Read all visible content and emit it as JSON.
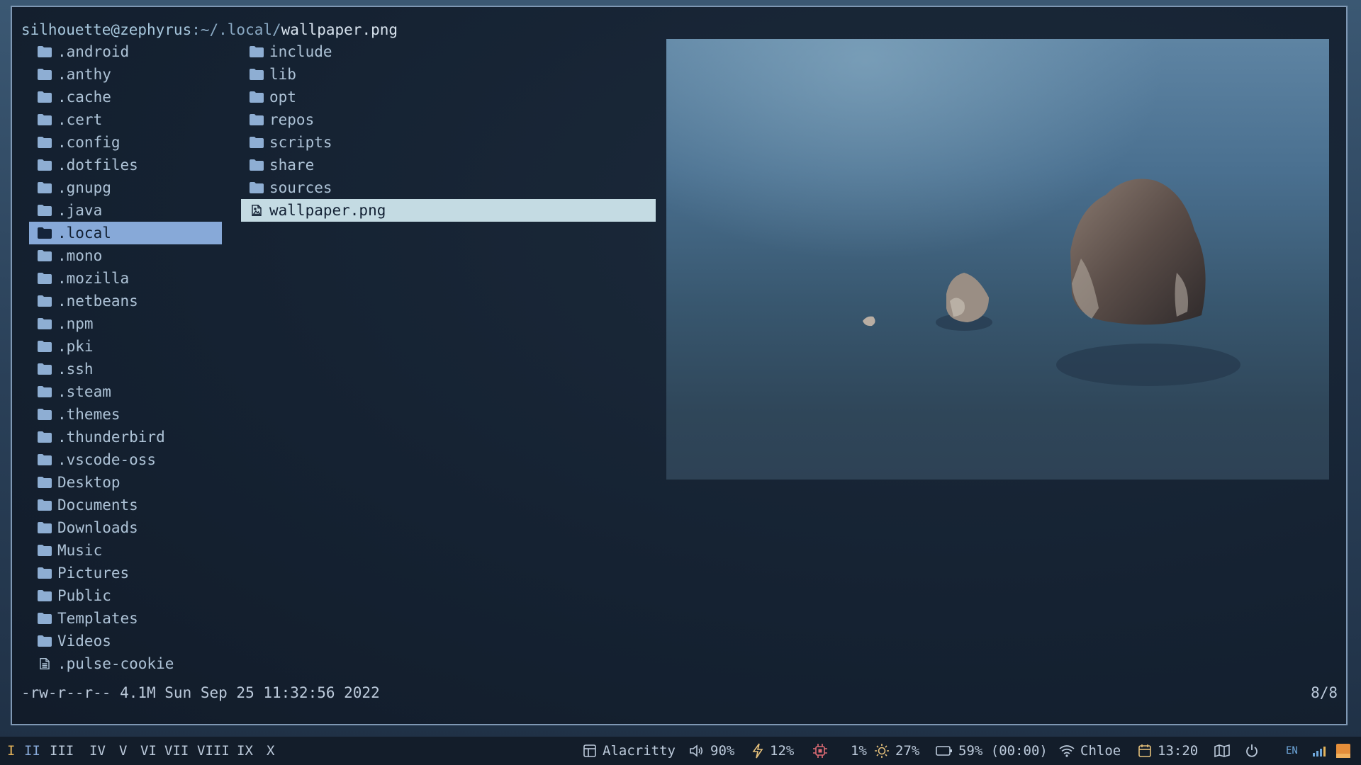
{
  "terminal": {
    "prompt_user": "silhouette@zephyrus",
    "prompt_path": ":~/.local/",
    "prompt_file": "wallpaper.png",
    "status": "-rw-r--r-- 4.1M Sun Sep 25 11:32:56 2022",
    "count": "8/8",
    "left_column": [
      ".android",
      ".anthy",
      ".cache",
      ".cert",
      ".config",
      ".dotfiles",
      ".gnupg",
      ".java",
      ".local",
      ".mono",
      ".mozilla",
      ".netbeans",
      ".npm",
      ".pki",
      ".ssh",
      ".steam",
      ".themes",
      ".thunderbird",
      ".vscode-oss",
      "Desktop",
      "Documents",
      "Downloads",
      "Music",
      "Pictures",
      "Public",
      "Templates",
      "Videos",
      ".pulse-cookie"
    ],
    "left_selected": ".local",
    "middle_column": [
      "include",
      "lib",
      "opt",
      "repos",
      "scripts",
      "share",
      "sources",
      "wallpaper.png"
    ],
    "middle_selected": "wallpaper.png"
  },
  "bar": {
    "workspaces": [
      "I",
      "II",
      "III",
      "IV",
      "V",
      "VI",
      "VII",
      "VIII",
      "IX",
      "X"
    ],
    "active_workspace": "I",
    "window": "Alacritty",
    "volume": "90%",
    "power": "12%",
    "cpu": "1%",
    "brightness": "27%",
    "battery": "59% (00:00)",
    "wifi": "Chloe",
    "time": "13:20",
    "lang": "EN"
  },
  "colors": {
    "accent_workspace": "#e5b45a",
    "selection_left": "#87a9d8",
    "selection_middle": "#c4dbe3",
    "cpu_icon": "#e06c75",
    "brightness_icon": "#e5c07b",
    "calendar_icon": "#e5c07b"
  },
  "icons": {
    "dir": "folder-icon",
    "file": "file-icon",
    "image": "image-file-icon",
    "window": "window-icon",
    "volume": "speaker-icon",
    "power": "lightning-icon",
    "cpu": "cpu-icon",
    "brightness": "sun-icon",
    "battery": "battery-icon",
    "wifi": "wifi-icon",
    "calendar": "calendar-icon",
    "map": "map-icon",
    "shutdown": "power-icon",
    "network_tray": "network-signal-icon",
    "tray_app": "tray-app-icon"
  }
}
